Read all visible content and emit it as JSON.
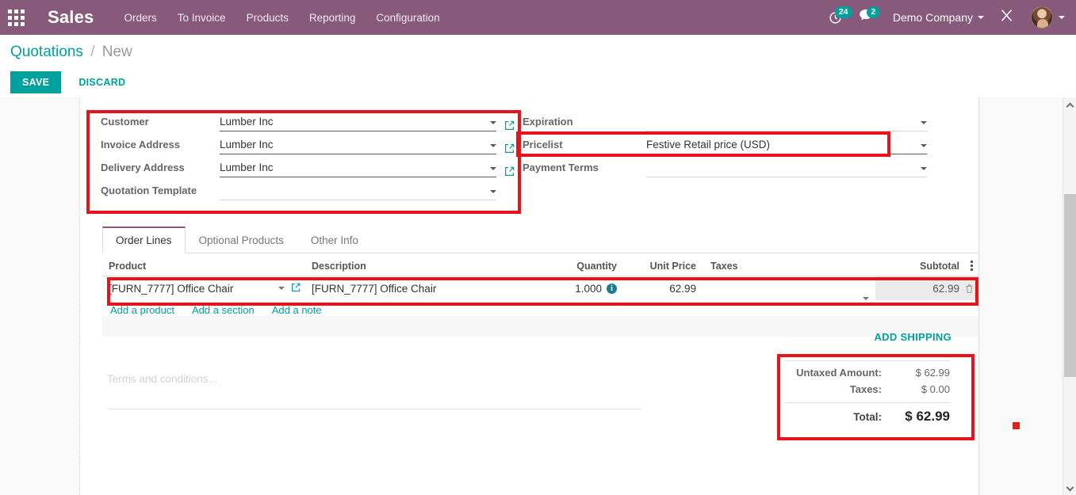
{
  "navbar": {
    "apps_icon": "apps-grid-icon",
    "brand": "Sales",
    "menu": [
      {
        "label": "Orders"
      },
      {
        "label": "To Invoice"
      },
      {
        "label": "Products"
      },
      {
        "label": "Reporting"
      },
      {
        "label": "Configuration"
      }
    ],
    "activity": {
      "icon": "clock-icon",
      "badge": "24"
    },
    "messages": {
      "icon": "chat-bubble-icon",
      "badge": "2"
    },
    "company": "Demo Company",
    "debug_icon": "wrench-tools-icon",
    "avatar_icon": "user-avatar"
  },
  "control_panel": {
    "breadcrumb_root": "Quotations",
    "breadcrumb_sep": "/",
    "breadcrumb_current": "New",
    "save_label": "SAVE",
    "discard_label": "DISCARD"
  },
  "form": {
    "left": [
      {
        "label": "Customer",
        "value": "Lumber Inc",
        "has_ext_link": true,
        "empty": false
      },
      {
        "label": "Invoice Address",
        "value": "Lumber Inc",
        "has_ext_link": true,
        "empty": false
      },
      {
        "label": "Delivery Address",
        "value": "Lumber Inc",
        "has_ext_link": true,
        "empty": false
      },
      {
        "label": "Quotation Template",
        "value": "",
        "has_ext_link": false,
        "empty": true
      }
    ],
    "right": [
      {
        "label": "Expiration",
        "value": "",
        "empty": true
      },
      {
        "label": "Pricelist",
        "value": "Festive Retail price (USD)",
        "empty": false
      },
      {
        "label": "Payment Terms",
        "value": "",
        "empty": true
      }
    ]
  },
  "notebook": {
    "tabs": [
      {
        "label": "Order Lines",
        "active": true
      },
      {
        "label": "Optional Products",
        "active": false
      },
      {
        "label": "Other Info",
        "active": false
      }
    ]
  },
  "order_lines": {
    "columns": {
      "product": "Product",
      "description": "Description",
      "quantity": "Quantity",
      "unit_price": "Unit Price",
      "taxes": "Taxes",
      "subtotal": "Subtotal"
    },
    "optional_columns_icon": "vertical-dots-icon",
    "rows": [
      {
        "product": "[FURN_7777] Office Chair",
        "description": "[FURN_7777] Office Chair",
        "quantity": "1.000",
        "quantity_info_icon": "info-icon",
        "unit_price": "62.99",
        "taxes": "",
        "subtotal": "62.99",
        "delete_icon": "trash-icon"
      }
    ],
    "add_links": [
      {
        "label": "Add a product"
      },
      {
        "label": "Add a section"
      },
      {
        "label": "Add a note"
      }
    ]
  },
  "terms": {
    "placeholder": "Terms and conditions..."
  },
  "totals": {
    "add_shipping_label": "ADD SHIPPING",
    "rows": [
      {
        "label": "Untaxed Amount:",
        "value": "$ 62.99"
      },
      {
        "label": "Taxes:",
        "value": "$ 0.00"
      }
    ],
    "grand": {
      "label": "Total:",
      "value": "$ 62.99"
    }
  },
  "colors": {
    "navbar": "#875A7B",
    "accent": "#00A09D",
    "highlight": "#e8131a",
    "marker": "#f01a1a"
  }
}
